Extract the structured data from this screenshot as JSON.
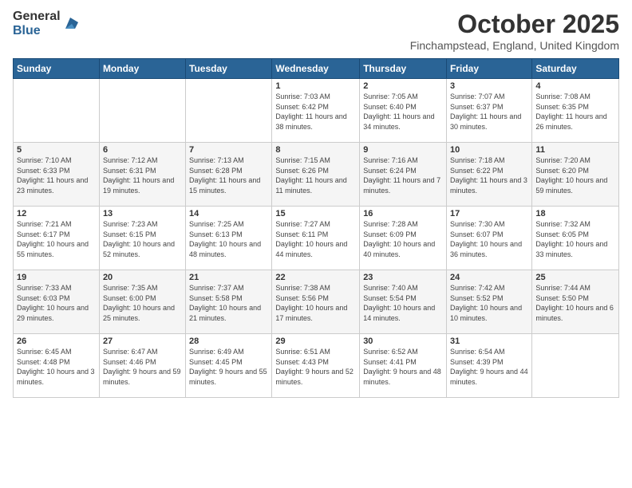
{
  "logo": {
    "general": "General",
    "blue": "Blue"
  },
  "header": {
    "month": "October 2025",
    "location": "Finchampstead, England, United Kingdom"
  },
  "weekdays": [
    "Sunday",
    "Monday",
    "Tuesday",
    "Wednesday",
    "Thursday",
    "Friday",
    "Saturday"
  ],
  "weeks": [
    [
      {
        "day": "",
        "info": ""
      },
      {
        "day": "",
        "info": ""
      },
      {
        "day": "",
        "info": ""
      },
      {
        "day": "1",
        "info": "Sunrise: 7:03 AM\nSunset: 6:42 PM\nDaylight: 11 hours and 38 minutes."
      },
      {
        "day": "2",
        "info": "Sunrise: 7:05 AM\nSunset: 6:40 PM\nDaylight: 11 hours and 34 minutes."
      },
      {
        "day": "3",
        "info": "Sunrise: 7:07 AM\nSunset: 6:37 PM\nDaylight: 11 hours and 30 minutes."
      },
      {
        "day": "4",
        "info": "Sunrise: 7:08 AM\nSunset: 6:35 PM\nDaylight: 11 hours and 26 minutes."
      }
    ],
    [
      {
        "day": "5",
        "info": "Sunrise: 7:10 AM\nSunset: 6:33 PM\nDaylight: 11 hours and 23 minutes."
      },
      {
        "day": "6",
        "info": "Sunrise: 7:12 AM\nSunset: 6:31 PM\nDaylight: 11 hours and 19 minutes."
      },
      {
        "day": "7",
        "info": "Sunrise: 7:13 AM\nSunset: 6:28 PM\nDaylight: 11 hours and 15 minutes."
      },
      {
        "day": "8",
        "info": "Sunrise: 7:15 AM\nSunset: 6:26 PM\nDaylight: 11 hours and 11 minutes."
      },
      {
        "day": "9",
        "info": "Sunrise: 7:16 AM\nSunset: 6:24 PM\nDaylight: 11 hours and 7 minutes."
      },
      {
        "day": "10",
        "info": "Sunrise: 7:18 AM\nSunset: 6:22 PM\nDaylight: 11 hours and 3 minutes."
      },
      {
        "day": "11",
        "info": "Sunrise: 7:20 AM\nSunset: 6:20 PM\nDaylight: 10 hours and 59 minutes."
      }
    ],
    [
      {
        "day": "12",
        "info": "Sunrise: 7:21 AM\nSunset: 6:17 PM\nDaylight: 10 hours and 55 minutes."
      },
      {
        "day": "13",
        "info": "Sunrise: 7:23 AM\nSunset: 6:15 PM\nDaylight: 10 hours and 52 minutes."
      },
      {
        "day": "14",
        "info": "Sunrise: 7:25 AM\nSunset: 6:13 PM\nDaylight: 10 hours and 48 minutes."
      },
      {
        "day": "15",
        "info": "Sunrise: 7:27 AM\nSunset: 6:11 PM\nDaylight: 10 hours and 44 minutes."
      },
      {
        "day": "16",
        "info": "Sunrise: 7:28 AM\nSunset: 6:09 PM\nDaylight: 10 hours and 40 minutes."
      },
      {
        "day": "17",
        "info": "Sunrise: 7:30 AM\nSunset: 6:07 PM\nDaylight: 10 hours and 36 minutes."
      },
      {
        "day": "18",
        "info": "Sunrise: 7:32 AM\nSunset: 6:05 PM\nDaylight: 10 hours and 33 minutes."
      }
    ],
    [
      {
        "day": "19",
        "info": "Sunrise: 7:33 AM\nSunset: 6:03 PM\nDaylight: 10 hours and 29 minutes."
      },
      {
        "day": "20",
        "info": "Sunrise: 7:35 AM\nSunset: 6:00 PM\nDaylight: 10 hours and 25 minutes."
      },
      {
        "day": "21",
        "info": "Sunrise: 7:37 AM\nSunset: 5:58 PM\nDaylight: 10 hours and 21 minutes."
      },
      {
        "day": "22",
        "info": "Sunrise: 7:38 AM\nSunset: 5:56 PM\nDaylight: 10 hours and 17 minutes."
      },
      {
        "day": "23",
        "info": "Sunrise: 7:40 AM\nSunset: 5:54 PM\nDaylight: 10 hours and 14 minutes."
      },
      {
        "day": "24",
        "info": "Sunrise: 7:42 AM\nSunset: 5:52 PM\nDaylight: 10 hours and 10 minutes."
      },
      {
        "day": "25",
        "info": "Sunrise: 7:44 AM\nSunset: 5:50 PM\nDaylight: 10 hours and 6 minutes."
      }
    ],
    [
      {
        "day": "26",
        "info": "Sunrise: 6:45 AM\nSunset: 4:48 PM\nDaylight: 10 hours and 3 minutes."
      },
      {
        "day": "27",
        "info": "Sunrise: 6:47 AM\nSunset: 4:46 PM\nDaylight: 9 hours and 59 minutes."
      },
      {
        "day": "28",
        "info": "Sunrise: 6:49 AM\nSunset: 4:45 PM\nDaylight: 9 hours and 55 minutes."
      },
      {
        "day": "29",
        "info": "Sunrise: 6:51 AM\nSunset: 4:43 PM\nDaylight: 9 hours and 52 minutes."
      },
      {
        "day": "30",
        "info": "Sunrise: 6:52 AM\nSunset: 4:41 PM\nDaylight: 9 hours and 48 minutes."
      },
      {
        "day": "31",
        "info": "Sunrise: 6:54 AM\nSunset: 4:39 PM\nDaylight: 9 hours and 44 minutes."
      },
      {
        "day": "",
        "info": ""
      }
    ]
  ]
}
